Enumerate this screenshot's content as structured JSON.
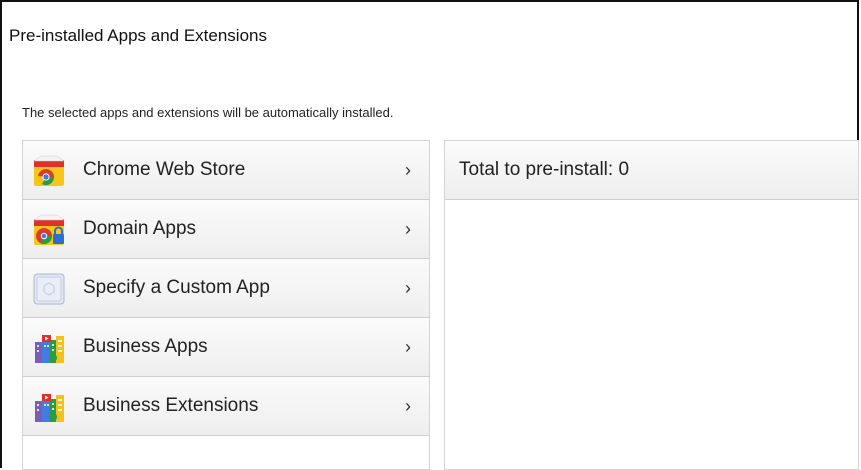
{
  "header": {
    "title": "Pre-installed Apps and Extensions",
    "subtitle": "The selected apps and extensions will be automatically installed."
  },
  "menu": {
    "items": [
      {
        "label": "Chrome Web Store",
        "icon": "chrome-web-store-icon",
        "chevron": "›"
      },
      {
        "label": "Domain Apps",
        "icon": "domain-apps-icon",
        "chevron": "›"
      },
      {
        "label": "Specify a Custom App",
        "icon": "custom-app-icon",
        "chevron": "›"
      },
      {
        "label": "Business Apps",
        "icon": "business-apps-icon",
        "chevron": "›"
      },
      {
        "label": "Business Extensions",
        "icon": "business-extensions-icon",
        "chevron": "›"
      }
    ]
  },
  "summary": {
    "total_label": "Total to pre-install: 0"
  },
  "colors": {
    "border": "#d4d4d4",
    "row_gradient_top": "#fbfbfb",
    "row_gradient_bottom": "#eeeeee"
  }
}
